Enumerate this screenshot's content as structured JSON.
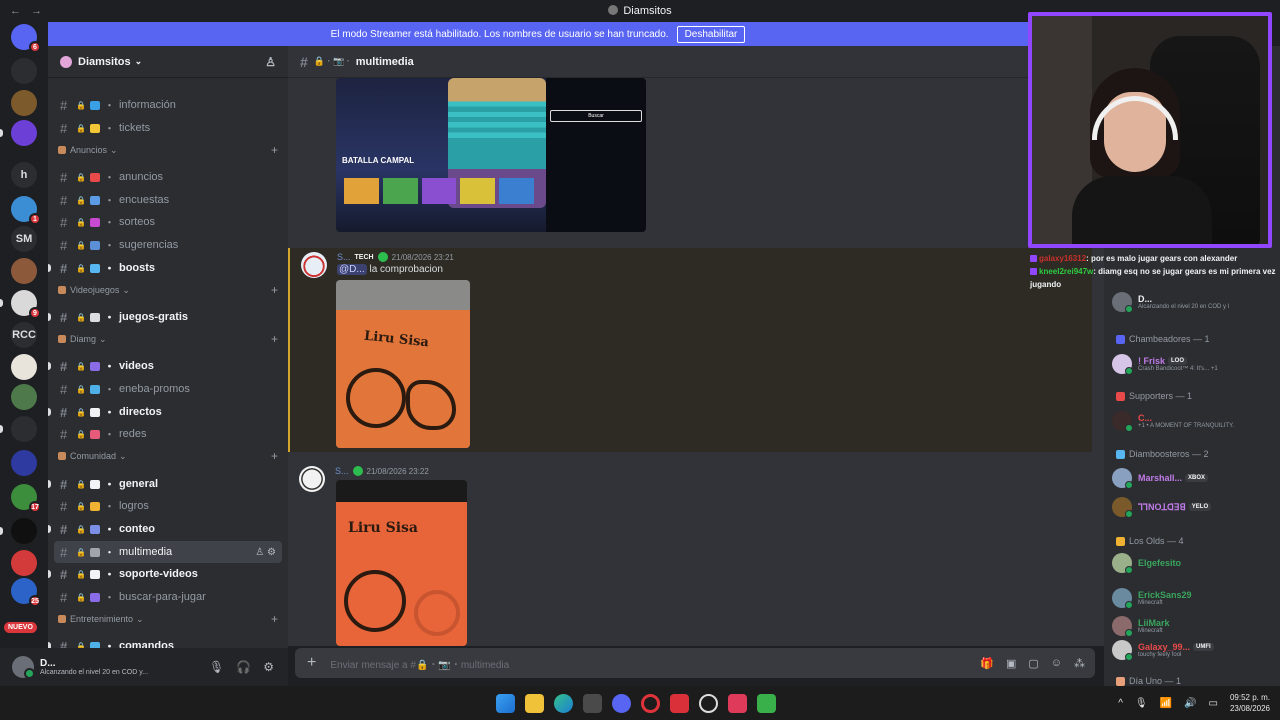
{
  "window": {
    "title": "Diamsitos",
    "back": "←",
    "forward": "→"
  },
  "banner": {
    "text": "El modo Streamer está habilitado. Los nombres de usuario se han truncado.",
    "button": "Deshabilitar"
  },
  "rail": {
    "new_label": "NUEVO",
    "servers": [
      {
        "label": "",
        "badge": "6",
        "color": "#5865f2"
      },
      {
        "label": "",
        "badge": "",
        "color": "#2b2d31"
      },
      {
        "label": "",
        "badge": "",
        "color": "#7d5a2c"
      },
      {
        "label": "",
        "badge": "",
        "color": "#6c3fd6"
      },
      {
        "label": "h",
        "badge": "",
        "color": "#2b2d31"
      },
      {
        "label": "",
        "badge": "1",
        "color": "#3b8dd4"
      },
      {
        "label": "SM",
        "badge": "",
        "color": "#2b2d31"
      },
      {
        "label": "",
        "badge": "",
        "color": "#8c5a3a"
      },
      {
        "label": "",
        "badge": "9",
        "color": "#d9d9d9"
      },
      {
        "label": "RCC",
        "badge": "",
        "color": "#2b2d31"
      },
      {
        "label": "",
        "badge": "",
        "color": "#e8e4dc"
      },
      {
        "label": "",
        "badge": "",
        "color": "#4e7a4b"
      },
      {
        "label": "",
        "badge": "",
        "color": "#2b2d31"
      },
      {
        "label": "",
        "badge": "",
        "color": "#2e3aa0"
      },
      {
        "label": "",
        "badge": "17",
        "color": "#3c8d3c"
      },
      {
        "label": "",
        "badge": "",
        "color": "#101010"
      },
      {
        "label": "",
        "badge": "",
        "color": "#d33b3b"
      },
      {
        "label": "",
        "badge": "25",
        "color": "#2c63c9"
      }
    ]
  },
  "sidebar": {
    "server_name": "Diamsitos",
    "chevron": "⌄",
    "add_member_icon": "♙",
    "categories": [
      {
        "name": "Anuncios"
      },
      {
        "name": "Videojuegos"
      },
      {
        "name": "Diamg"
      },
      {
        "name": "Comunidad"
      },
      {
        "name": "Entretenimiento"
      }
    ],
    "channels": [
      {
        "name": "información",
        "emoji": "#3aa0e6",
        "state": "read"
      },
      {
        "name": "tickets",
        "emoji": "#f3c637",
        "state": "read"
      },
      {
        "name": "anuncios",
        "emoji": "#e84a4a",
        "state": "read"
      },
      {
        "name": "encuestas",
        "emoji": "#5c9ce6",
        "state": "read"
      },
      {
        "name": "sorteos",
        "emoji": "#c84ad0",
        "state": "read"
      },
      {
        "name": "sugerencias",
        "emoji": "#5b8fd6",
        "state": "read"
      },
      {
        "name": "boosts",
        "emoji": "#58b7f0",
        "state": "unread"
      },
      {
        "name": "juegos-gratis",
        "emoji": "#dbdee1",
        "state": "unread"
      },
      {
        "name": "videos",
        "emoji": "#8a6be8",
        "state": "unread"
      },
      {
        "name": "eneba-promos",
        "emoji": "#4fb0e8",
        "state": "read"
      },
      {
        "name": "directos",
        "emoji": "#f2f3f5",
        "state": "unread"
      },
      {
        "name": "redes",
        "emoji": "#e65a7a",
        "state": "read"
      },
      {
        "name": "general",
        "emoji": "#f2f3f5",
        "state": "unread"
      },
      {
        "name": "logros",
        "emoji": "#f0b232",
        "state": "read"
      },
      {
        "name": "conteo",
        "emoji": "#7b8fe6",
        "state": "unread"
      },
      {
        "name": "multimedia",
        "emoji": "#a0a4ab",
        "state": "active"
      },
      {
        "name": "soporte-videos",
        "emoji": "#f2f3f5",
        "state": "unread"
      },
      {
        "name": "buscar-para-jugar",
        "emoji": "#8a6be8",
        "state": "read"
      },
      {
        "name": "comandos",
        "emoji": "#4fb0e8",
        "state": "unread"
      }
    ]
  },
  "user_panel": {
    "name": "D...",
    "status": "Alcanzando el nivel 20 en COD y..."
  },
  "chat_header": {
    "channel": "multimedia"
  },
  "messages": [
    {
      "user": "S...",
      "tag": "TECH",
      "time": "21/08/2026 23:21",
      "mention": "@D...",
      "text": "la comprobacion"
    },
    {
      "user": "S...",
      "tag": "",
      "time": "21/08/2026 23:22",
      "mention": "",
      "text": ""
    }
  ],
  "screenshot_image": {
    "title": "BATALLA CAMPAL",
    "button": "Buscar"
  },
  "photo_text": "Liru Sisa",
  "composer": {
    "placeholder": "Enviar mensaje a #🔒・📷・multimedia"
  },
  "twitch_chat": [
    {
      "user": "galaxy16312",
      "text": ": por es malo jugar gears con alexander"
    },
    {
      "user": "kneel2rei947w",
      "text": ": diamg esq no se jugar gears es mi primera vez jugando"
    }
  ],
  "members": {
    "top_member": {
      "name": "D...",
      "status": "Alcanzando el nivel 20 en COD y l"
    },
    "groups": [
      {
        "title": "Chambeadores — 1",
        "color": "#5865f2"
      },
      {
        "title": "Supporters — 1",
        "color": "#e84a4a"
      },
      {
        "title": "Diamboosteros — 2",
        "color": "#58b7f0"
      },
      {
        "title": "Los Olds — 4",
        "color": "#f0b232"
      },
      {
        "title": "Día Uno — 1",
        "color": "#e8a07a"
      }
    ],
    "list": [
      {
        "name": "! Frisk",
        "tag": "LOO",
        "status": "Crash Bandicoot™ 4: It's... +1",
        "color": "#c07be8",
        "av": "#d7c5e8"
      },
      {
        "name": "C...",
        "tag": "",
        "status": "+1 • A MOMENT OF TRANQUILITY.",
        "color": "#e84a4a",
        "av": "#3a2a2a"
      },
      {
        "name": "Marshall...",
        "tag": "XBOX",
        "status": "",
        "color": "#c07be8",
        "av": "#8aa0c0"
      },
      {
        "name": "ꓶꓶNOꓕꓷꓱꓭ",
        "tag": "YELO",
        "status": "",
        "color": "#c07be8",
        "av": "#7a5a2a"
      },
      {
        "name": "Elgefesito",
        "tag": "",
        "status": "",
        "color": "#3ba55d",
        "av": "#9ab08a"
      },
      {
        "name": "ErickSans29",
        "tag": "",
        "status": "Minecraft",
        "color": "#3ba55d",
        "av": "#6a8aa0"
      },
      {
        "name": "LiiMark",
        "tag": "",
        "status": "Minecraft",
        "color": "#3ba55d",
        "av": "#8a6a6a"
      },
      {
        "name": "Galaxy_99...",
        "tag": "UMFI",
        "status": "touchy feely fool",
        "color": "#e84a4a",
        "av": "#c8c8c8"
      }
    ]
  },
  "taskbar": {
    "time": "09:52 p. m.",
    "date": "23/08/2026",
    "chevron": "^"
  }
}
